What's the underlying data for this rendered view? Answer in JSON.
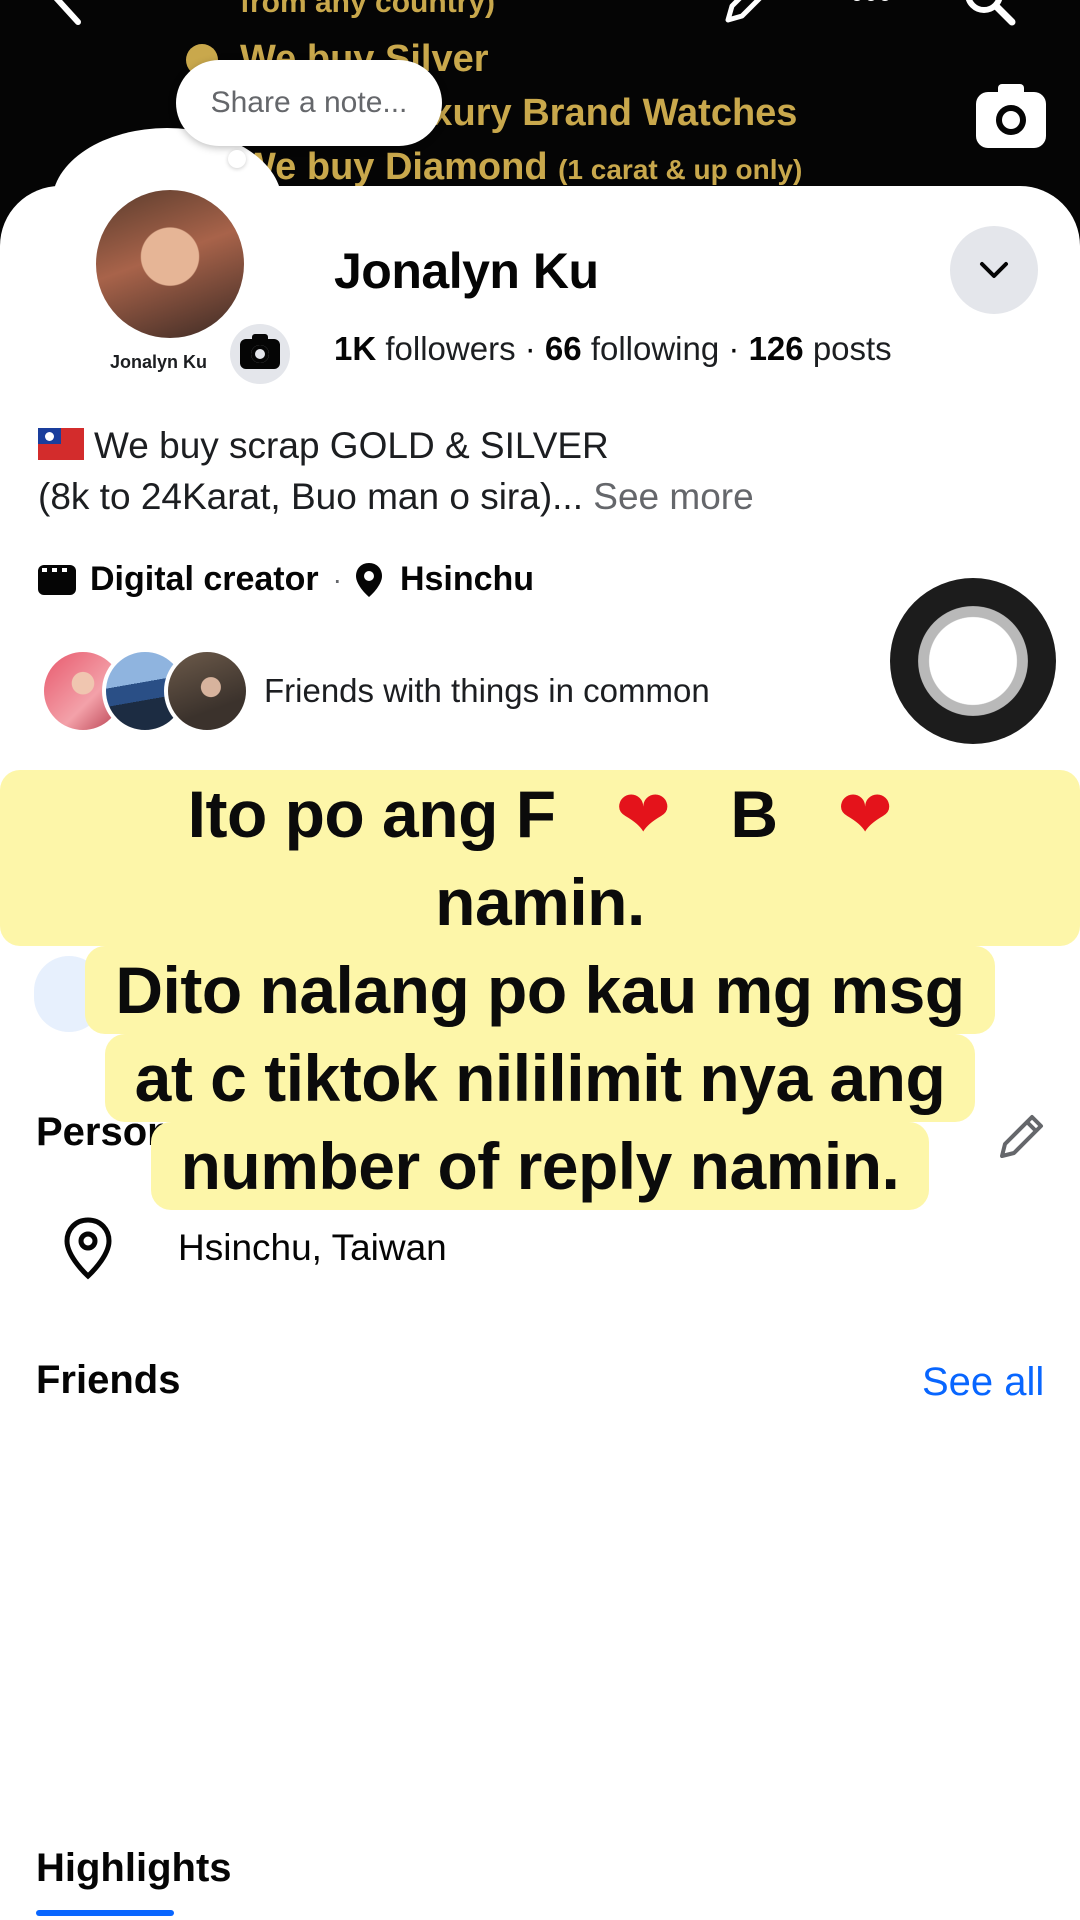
{
  "cover": {
    "lines": [
      "from any country)",
      "We buy Silver",
      "We buy Luxury Brand Watches",
      "We buy Diamond"
    ],
    "diamond_note": "(1 carat & up only)"
  },
  "note": {
    "placeholder": "Share a note..."
  },
  "profile": {
    "avatar_caption": "Jonalyn Ku",
    "name": "Jonalyn Ku",
    "followers_count": "1K",
    "followers_label": "followers",
    "following_count": "66",
    "following_label": "following",
    "posts_count": "126",
    "posts_label": "posts",
    "separator": "·"
  },
  "bio": {
    "line1": "We buy scrap GOLD & SILVER",
    "line2": "(8k to 24Karat, Buo man o sira)...",
    "see_more": "See more"
  },
  "meta": {
    "category": "Digital creator",
    "separator": "·",
    "location": "Hsinchu"
  },
  "mutual": {
    "text": "Friends with things in common"
  },
  "caption": {
    "line1_part1": "Ito po ang F",
    "line1_part2": "B",
    "line1_part3": " namin.",
    "line2": "Dito nalang po kau mg msg",
    "line3": "at c tiktok nililimit nya ang",
    "line4": "number of reply namin.",
    "heart": "❤"
  },
  "personal_details": {
    "title": "Personal details",
    "location": "Hsinchu, Taiwan"
  },
  "friends": {
    "title": "Friends",
    "see_all": "See all"
  },
  "highlights": {
    "title": "Highlights"
  },
  "colors": {
    "accent": "#0866ff",
    "caption_bg": "#fdf6a9",
    "cover_text": "#c9a84c",
    "heart": "#e4131b"
  }
}
